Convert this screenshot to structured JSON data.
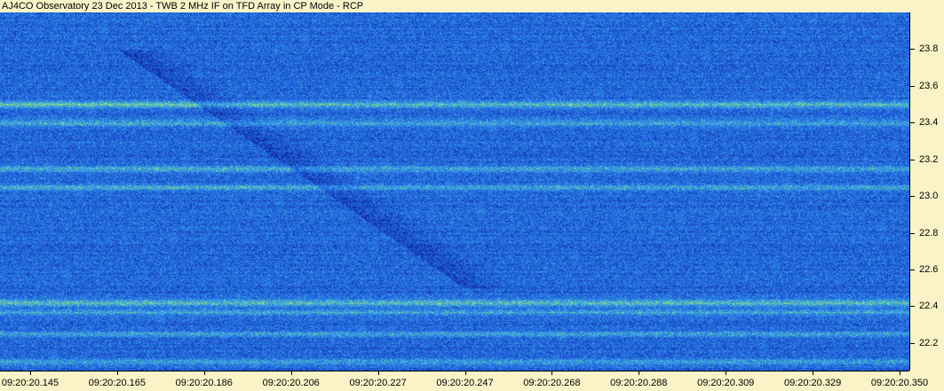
{
  "window": {
    "title": "AJ4CO Observatory 23 Dec 2013 - TWB 2 MHz IF on TFD Array in CP Mode - RCP"
  },
  "chart_data": {
    "type": "heatmap",
    "title": "AJ4CO Observatory 23 Dec 2013 - TWB 2 MHz IF on TFD Array in CP Mode - RCP",
    "xlabel": "",
    "ylabel": "",
    "x_ticks": [
      "09:20:20.145",
      "09:20:20.165",
      "09:20:20.186",
      "09:20:20.206",
      "09:20:20.227",
      "09:20:20.247",
      "09:20:20.268",
      "09:20:20.288",
      "09:20:20.309",
      "09:20:20.329",
      "09:20:20.350"
    ],
    "y_ticks": [
      22.2,
      22.4,
      22.6,
      22.8,
      23.0,
      23.2,
      23.4,
      23.6,
      23.8
    ],
    "ylim": [
      22.05,
      24.0
    ],
    "grid": false,
    "colormap": [
      "#0a1f8c",
      "#1a4fd0",
      "#2a7ae8",
      "#3fb0e0",
      "#8ee07a",
      "#f2e23a",
      "#f08020"
    ],
    "bright_bands_mhz": [
      23.5,
      23.4,
      23.15,
      23.05,
      22.42,
      22.37,
      22.25,
      22.1
    ],
    "drift_feature": {
      "description": "descending burst",
      "start": {
        "x": "09:20:20.165",
        "y": 23.8
      },
      "end": {
        "x": "09:20:20.247",
        "y": 22.5
      }
    }
  },
  "colors": {
    "background": "#fbf3c8",
    "plot_base": "#1e3fae"
  }
}
